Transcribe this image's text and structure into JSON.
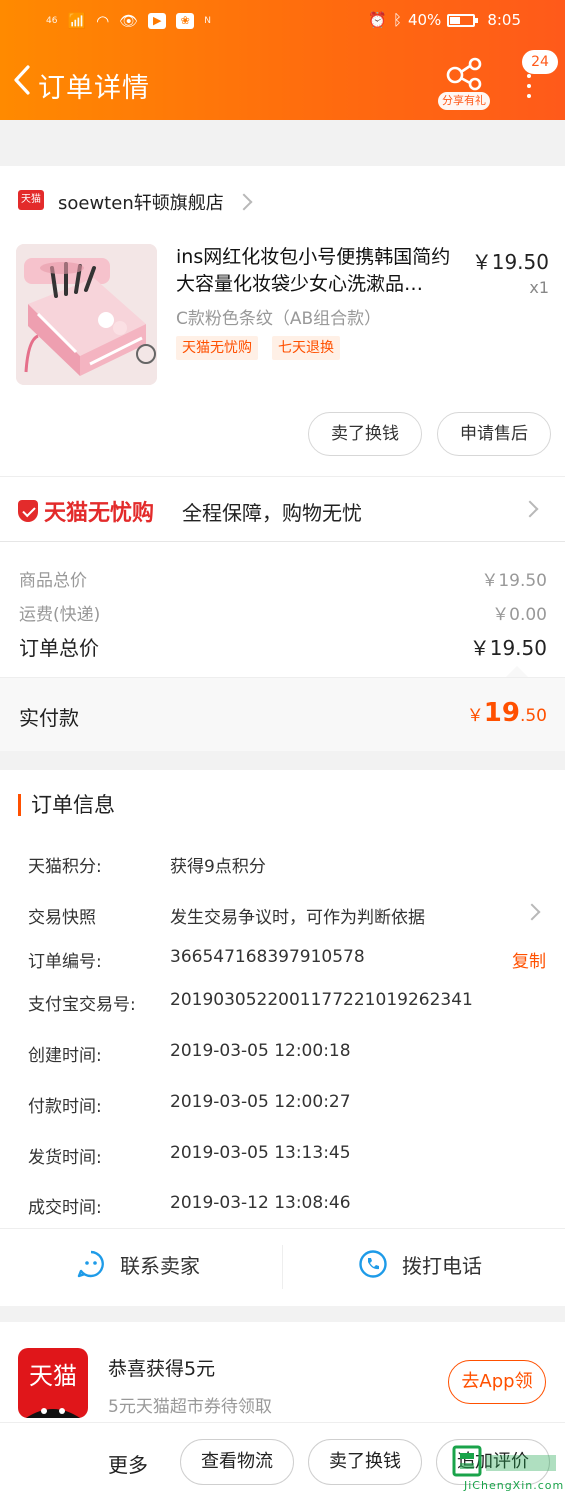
{
  "status_bar": {
    "network": "46",
    "nfc": "N",
    "battery": "40%",
    "time": "8:05"
  },
  "header": {
    "title": "订单详情",
    "share_label": "分享有礼",
    "badge_count": "24"
  },
  "shop": {
    "badge": "天猫",
    "name": "soewten轩顿旗舰店"
  },
  "product": {
    "title": "ins网红化妆包小号便携韩国简约大容量化妆袋少女心洗漱品…",
    "price": "￥19.50",
    "qty": "x1",
    "spec": "C款粉色条纹（AB组合款）",
    "tags": [
      "天猫无忧购",
      "七天退换"
    ],
    "actions": [
      "卖了换钱",
      "申请售后"
    ]
  },
  "guarantee": {
    "brand": "天猫无忧购",
    "text": "全程保障，购物无忧"
  },
  "costs": {
    "items_label": "商品总价",
    "items_value": "￥19.50",
    "shipping_label": "运费(快递)",
    "shipping_value": "￥0.00",
    "order_total_label": "订单总价",
    "order_total_value": "￥19.50",
    "paid_label": "实付款",
    "paid_currency": "￥",
    "paid_int": "19",
    "paid_dec": ".50"
  },
  "order_info": {
    "title": "订单信息",
    "rows": [
      {
        "label": "天猫积分:",
        "value": "获得9点积分"
      },
      {
        "label": "交易快照",
        "value": "发生交易争议时，可作为判断依据"
      },
      {
        "label": "订单编号:",
        "value": "366547168397910578"
      },
      {
        "label": "支付宝交易号:",
        "value": "2019030522001177221019262341"
      },
      {
        "label": "创建时间:",
        "value": "2019-03-05 12:00:18"
      },
      {
        "label": "付款时间:",
        "value": "2019-03-05 12:00:27"
      },
      {
        "label": "发货时间:",
        "value": "2019-03-05 13:13:45"
      },
      {
        "label": "成交时间:",
        "value": "2019-03-12 13:08:46"
      }
    ],
    "copy_label": "复制"
  },
  "contact": {
    "seller": "联系卖家",
    "call": "拨打电话"
  },
  "promo": {
    "app_name": "天猫",
    "title": "恭喜获得5元",
    "subtitle": "5元天猫超市券待领取",
    "button": "去App领"
  },
  "bottom_bar": {
    "more": "更多",
    "buttons": [
      "查看物流",
      "卖了换钱",
      "追加评价"
    ]
  },
  "watermark": {
    "text": "JiChengXin.com"
  }
}
